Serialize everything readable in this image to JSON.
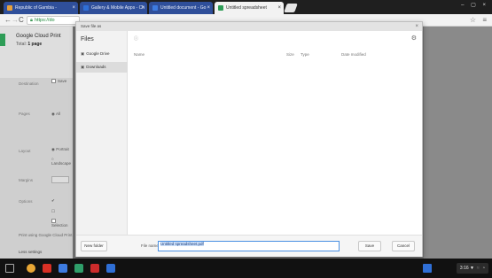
{
  "tabs": [
    {
      "label": "Republic of Gambia -",
      "color": "#e9a23b"
    },
    {
      "label": "Gallery & Mobile Apps - Ch",
      "color": "#2f6fd6"
    },
    {
      "label": "Untitled document - Go",
      "color": "#3d7be0"
    },
    {
      "label": "Untitled spreadsheet",
      "color": "#2e9d57"
    }
  ],
  "toolbar": {
    "back": "←",
    "forward": "→",
    "reload": "C",
    "url": "https://do",
    "star": "☆",
    "menu": "≡"
  },
  "print_panel": {
    "title": "Google Cloud Print",
    "sheets_prefix": "Total:",
    "sheets_value": "1 page",
    "destination_label": "Destination",
    "destination_value": "Save",
    "pages_label": "Pages",
    "pages_value": "All",
    "layout_label": "Layout",
    "layout_value": "Portrait",
    "layout_value2": "Landscape",
    "margins_label": "Margins",
    "options_label": "Options",
    "options_value": "Selection",
    "footer_text": "Print using Google Cloud Print",
    "footer_text2": "Less settings"
  },
  "dialog": {
    "window_title": "Save file as",
    "close": "×",
    "sidebar_title": "Files",
    "sidebar_items": [
      {
        "label": "Google Drive",
        "icon": "drive-icon"
      },
      {
        "label": "Downloads",
        "icon": "folder-icon"
      }
    ],
    "path_hint": "ⓘ",
    "columns": [
      "Name",
      "Size",
      "Type",
      "Date modified"
    ],
    "new_folder": "New folder",
    "filename_label": "File name:",
    "filename_value": "Untitled spreadsheet.pdf",
    "save": "Save",
    "cancel": "Cancel"
  },
  "taskbar": {
    "tray_text": "3:16 ▼ ◾ ◔",
    "apps": [
      {
        "name": "chrome-icon",
        "color": "#e8a735"
      },
      {
        "name": "gmail-icon",
        "color": "#d93025"
      },
      {
        "name": "docs-icon",
        "color": "#3d7be0"
      },
      {
        "name": "drive-icon",
        "color": "#2f9e6a"
      },
      {
        "name": "youtube-icon",
        "color": "#cc2b2b"
      },
      {
        "name": "files-icon",
        "color": "#2f6fd6"
      }
    ]
  }
}
